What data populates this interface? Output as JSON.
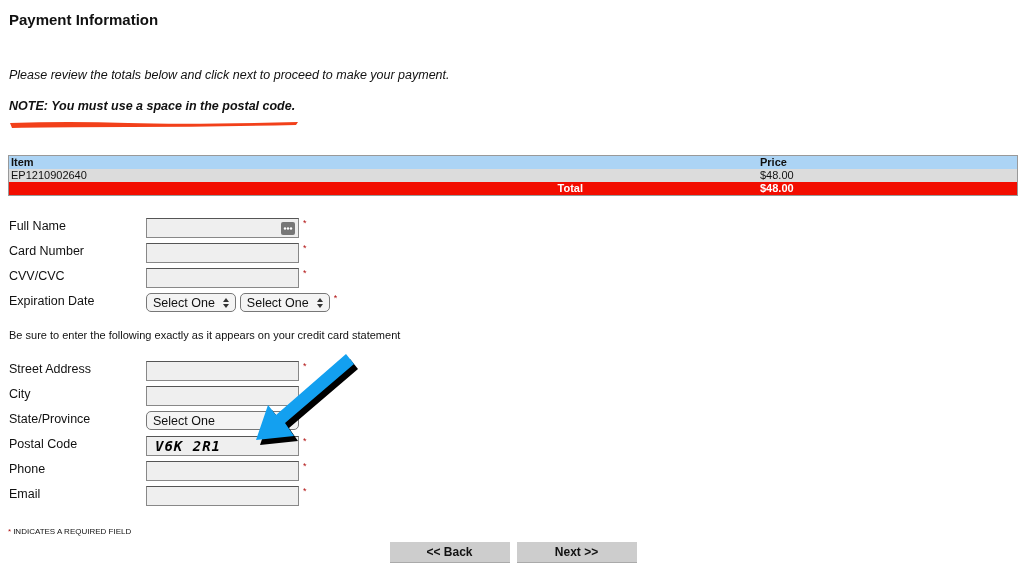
{
  "title": "Payment Information",
  "intro": "Please review the totals below and click next to proceed to make your payment.",
  "note": "NOTE: You must use a space in the postal code.",
  "table": {
    "columns": [
      "Item",
      "Price"
    ],
    "rows": [
      {
        "kind": "item",
        "cells": [
          "EP1210902640",
          "$48.00"
        ]
      },
      {
        "kind": "total",
        "cells": [
          "Total",
          "$48.00"
        ]
      }
    ]
  },
  "card_fields": [
    {
      "label": "Full Name",
      "kind": "text",
      "has_autofill_icon": true,
      "mark": "*"
    },
    {
      "label": "Card Number",
      "kind": "text",
      "mark": "*"
    },
    {
      "label": "CVV/CVC",
      "kind": "text",
      "mark": "*"
    },
    {
      "label": "Expiration Date",
      "kind": "selects",
      "selects": [
        "Select One",
        "Select One"
      ],
      "mark": "*"
    }
  ],
  "address_hint": "Be sure to enter the following exactly as it appears on your credit card statement",
  "address_fields": [
    {
      "label": "Street Address",
      "kind": "text",
      "mark": "*"
    },
    {
      "label": "City",
      "kind": "text"
    },
    {
      "label": "State/Province",
      "kind": "selects",
      "selects": [
        "Select One"
      ]
    },
    {
      "label": "Postal Code",
      "kind": "text",
      "value": "V6K 2R1",
      "mark": "*"
    },
    {
      "label": "Phone",
      "kind": "text",
      "mark": "*"
    },
    {
      "label": "Email",
      "kind": "text",
      "mark": "*"
    }
  ],
  "footnote": {
    "mark": "*",
    "text": "INDICATES A REQUIRED FIELD"
  },
  "buttons": [
    "<< Back",
    "Next >>"
  ]
}
